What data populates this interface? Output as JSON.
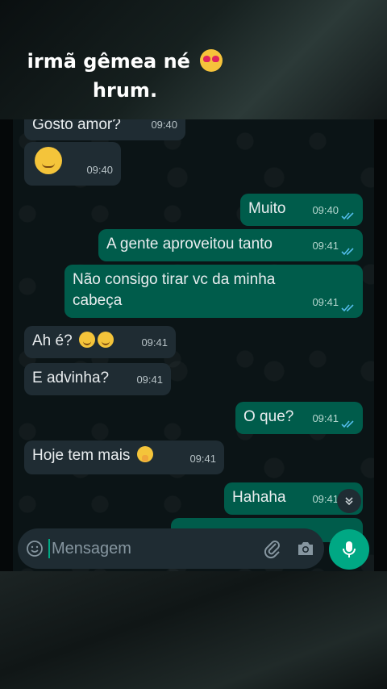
{
  "caption": {
    "line1": "irmã gêmea né",
    "line2": "hrum.",
    "emoji": "heart-eyes-emoji"
  },
  "messages": [
    {
      "dir": "in",
      "text": "Gosto amor?",
      "time": "09:40"
    },
    {
      "dir": "in",
      "text": "",
      "emoji": "smirk-emoji",
      "time": "09:40"
    },
    {
      "dir": "out",
      "text": "Muito",
      "time": "09:40",
      "status": "read"
    },
    {
      "dir": "out",
      "text": "A gente aproveitou tanto",
      "time": "09:41",
      "status": "read"
    },
    {
      "dir": "out",
      "text": "Não consigo tirar vc da minha\ncabeça",
      "time": "09:41",
      "status": "read"
    },
    {
      "dir": "in",
      "text": "Ah é?",
      "emoji": "smirk-emoji x2",
      "time": "09:41"
    },
    {
      "dir": "in",
      "text": "E advinha?",
      "time": "09:41"
    },
    {
      "dir": "out",
      "text": "O que?",
      "time": "09:41",
      "status": "read"
    },
    {
      "dir": "in",
      "text": "Hoje tem mais",
      "emoji": "shushing-face-emoji",
      "time": "09:41"
    },
    {
      "dir": "out",
      "text": "Hahaha",
      "time": "09:41",
      "status": "read"
    }
  ],
  "composer": {
    "placeholder": "Mensagem"
  },
  "colors": {
    "incoming": "#1f2c33",
    "outgoing": "#005c4b",
    "accent": "#00a884",
    "read_ticks": "#53bdeb"
  }
}
